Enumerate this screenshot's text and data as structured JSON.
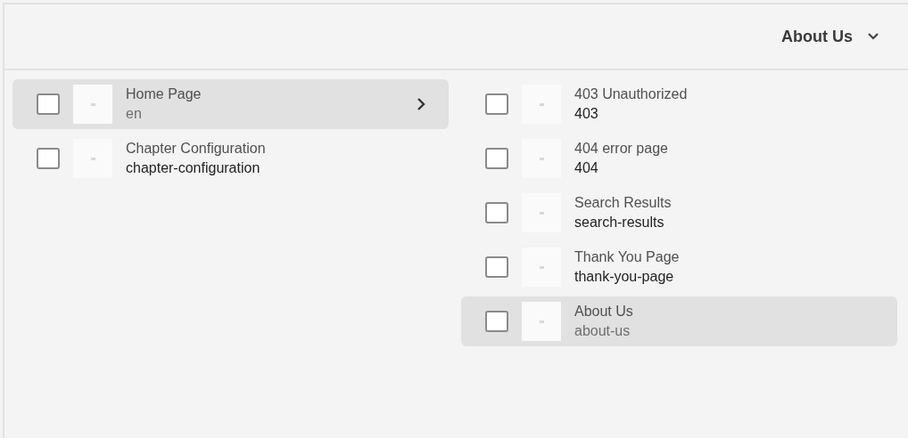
{
  "header": {
    "title": "About Us",
    "expanded": false
  },
  "columns": [
    {
      "items": [
        {
          "title": "Home Page",
          "name": "en",
          "selected": true,
          "checked": false,
          "has_children": true
        },
        {
          "title": "Chapter Configuration",
          "name": "chapter-configuration",
          "selected": false,
          "checked": false,
          "has_children": false
        }
      ]
    },
    {
      "items": [
        {
          "title": "403 Unauthorized",
          "name": "403",
          "selected": false,
          "checked": false,
          "has_children": false
        },
        {
          "title": "404 error page",
          "name": "404",
          "selected": false,
          "checked": false,
          "has_children": false
        },
        {
          "title": "Search Results",
          "name": "search-results",
          "selected": false,
          "checked": false,
          "has_children": false
        },
        {
          "title": "Thank You Page",
          "name": "thank-you-page",
          "selected": false,
          "checked": false,
          "has_children": false
        },
        {
          "title": "About Us",
          "name": "about-us",
          "selected": true,
          "checked": false,
          "has_children": false
        }
      ]
    }
  ]
}
